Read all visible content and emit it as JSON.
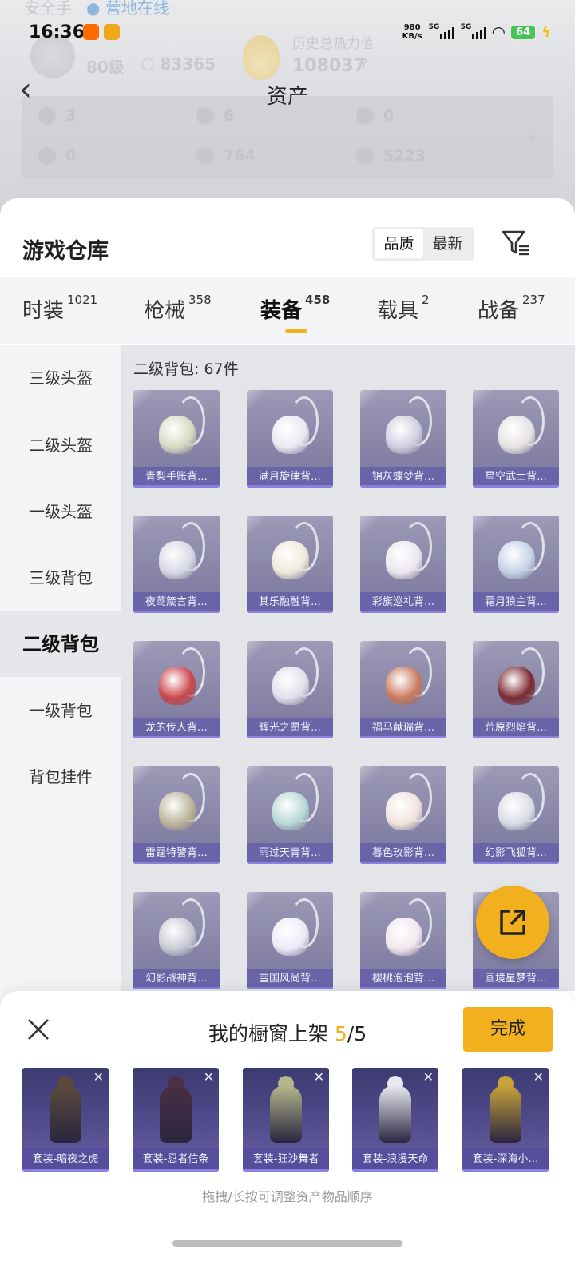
{
  "status_bar": {
    "time": "16:36",
    "speed_value": "980",
    "speed_unit": "KB/s",
    "net1": "5G",
    "net2": "5G",
    "battery": "64"
  },
  "background_header": {
    "player_label": "安全手",
    "online_status": "营地在线",
    "level": "80级",
    "coins": "83365",
    "history_heat_label": "历史总热力值",
    "history_heat_value": "108037",
    "help": "?",
    "assets": [
      "3",
      "6",
      "0",
      "0",
      "764",
      "5223"
    ],
    "more": "»"
  },
  "header": {
    "title": "资产",
    "back_icon": "chevron-left-icon"
  },
  "warehouse": {
    "title": "游戏仓库",
    "sort_options": [
      "品质",
      "最新"
    ],
    "active_sort": "品质",
    "filter_icon": "filter-icon"
  },
  "category_tabs": [
    {
      "label": "时装",
      "count": "1021"
    },
    {
      "label": "枪械",
      "count": "358"
    },
    {
      "label": "装备",
      "count": "458",
      "active": true
    },
    {
      "label": "载具",
      "count": "2"
    },
    {
      "label": "战备",
      "count": "237"
    }
  ],
  "sidebar": [
    {
      "label": "三级头盔"
    },
    {
      "label": "二级头盔"
    },
    {
      "label": "一级头盔"
    },
    {
      "label": "三级背包"
    },
    {
      "label": "二级背包",
      "active": true
    },
    {
      "label": "一级背包"
    },
    {
      "label": "背包挂件"
    }
  ],
  "grid": {
    "header": "二级背包: 67件",
    "items": [
      {
        "label": "青梨手账背…",
        "color": "#d8d9c4"
      },
      {
        "label": "满月旋律背…",
        "color": "#e8e9f2"
      },
      {
        "label": "锦灰蝶梦背…",
        "color": "#cfcfe0"
      },
      {
        "label": "星空武士背…",
        "color": "#e7e2e4"
      },
      {
        "label": "夜莺箴言背…",
        "color": "#d7d8e6"
      },
      {
        "label": "其乐融融背…",
        "color": "#f0e8dc"
      },
      {
        "label": "彩旗巡礼背…",
        "color": "#ece6ee"
      },
      {
        "label": "霜月狼主背…",
        "color": "#c6d2e6"
      },
      {
        "label": "龙的传人背…",
        "color": "#c9454b"
      },
      {
        "label": "辉光之愿背…",
        "color": "#dfe0ea"
      },
      {
        "label": "福马献瑞背…",
        "color": "#c97a5e"
      },
      {
        "label": "荒原烈焰背…",
        "color": "#7b2a32"
      },
      {
        "label": "雷霆特警背…",
        "color": "#bdb59c"
      },
      {
        "label": "雨过天青背…",
        "color": "#b8d8d6"
      },
      {
        "label": "暮色玫影背…",
        "color": "#f1e4dc"
      },
      {
        "label": "幻影飞狐背…",
        "color": "#d9dde4"
      },
      {
        "label": "幻影战神背…",
        "color": "#c9cbd4"
      },
      {
        "label": "雪国风尚背…",
        "color": "#ecebf6"
      },
      {
        "label": "樱桃泡泡背…",
        "color": "#f2e6ee"
      },
      {
        "label": "画境星梦背…",
        "color": "#d8d4e6"
      }
    ]
  },
  "share_button": {
    "icon": "share-external-icon"
  },
  "showcase": {
    "title_prefix": "我的橱窗上架",
    "current": "5",
    "separator": "/",
    "max": "5",
    "done_label": "完成",
    "close_icon": "close-icon",
    "slots": [
      {
        "label": "套装-暗夜之虎",
        "color": "#5b4a3c",
        "remove": "✕"
      },
      {
        "label": "套装-忍者信条",
        "color": "#4a2f45",
        "remove": "✕"
      },
      {
        "label": "套装-狂沙舞者",
        "color": "#b4b68a",
        "remove": "✕"
      },
      {
        "label": "套装-浪漫天命",
        "color": "#e8e9f0",
        "remove": "✕"
      },
      {
        "label": "套装-深海小…",
        "color": "#c7a23a",
        "remove": "✕"
      }
    ],
    "hint": "拖拽/长按可调整资产物品顺序"
  }
}
